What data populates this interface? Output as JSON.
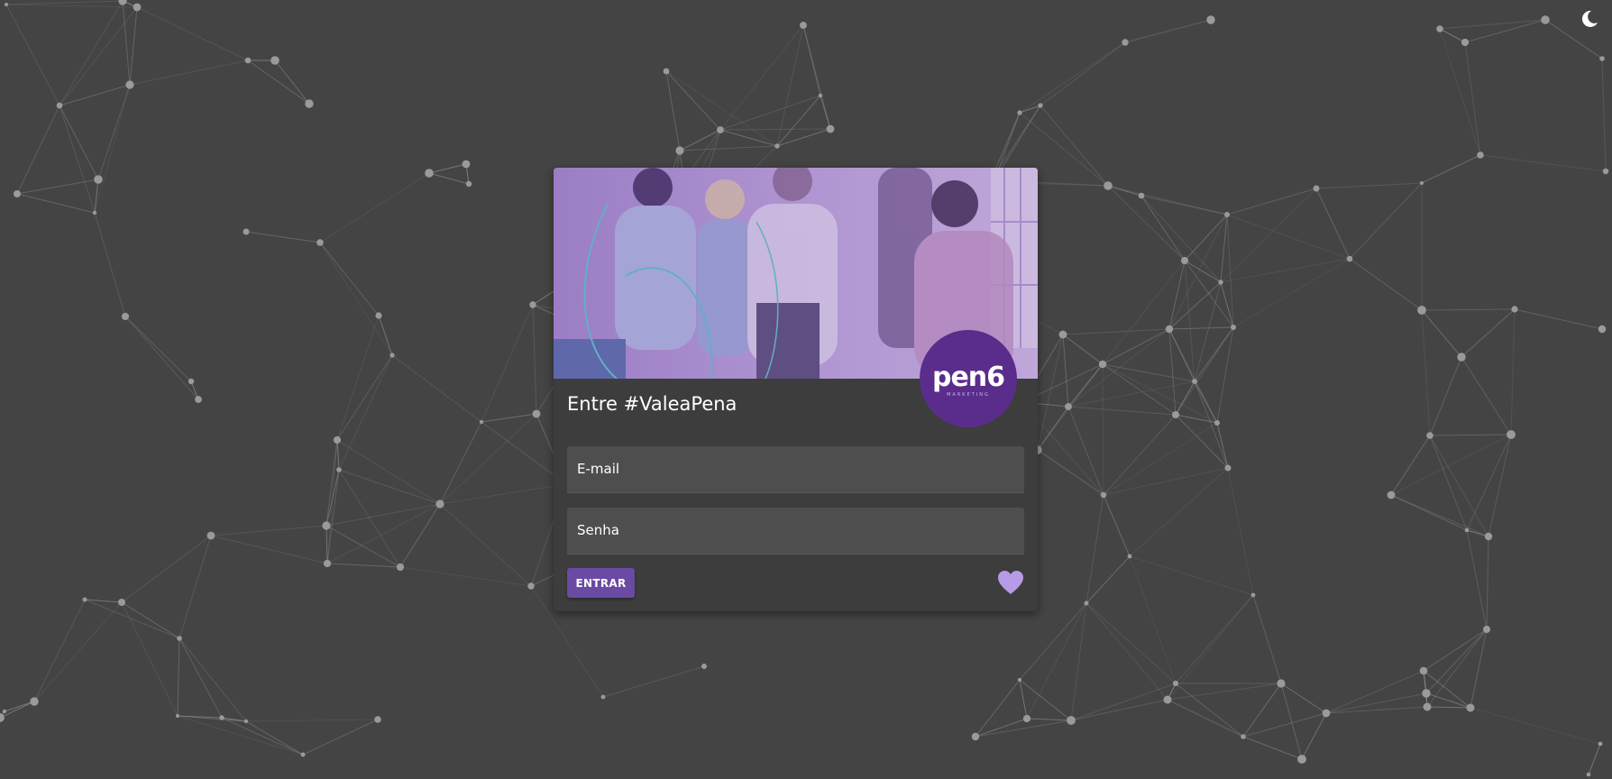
{
  "login": {
    "title": "Entre #ValeaPena",
    "email_label": "E-mail",
    "password_label": "Senha",
    "submit_label": "ENTRAR"
  },
  "logo": {
    "wordmark": "pen6",
    "tagline": "MARKETING"
  },
  "icons": {
    "theme_toggle": "moon-icon",
    "like": "heart-icon"
  },
  "colors": {
    "background": "#444444",
    "card": "#3d3d3d",
    "field": "#4e4e4e",
    "accent": "#6a4aa3",
    "logo_circle": "#5a2d8c",
    "heart": "#b79be6",
    "network_lines": "#8a8a8a"
  }
}
